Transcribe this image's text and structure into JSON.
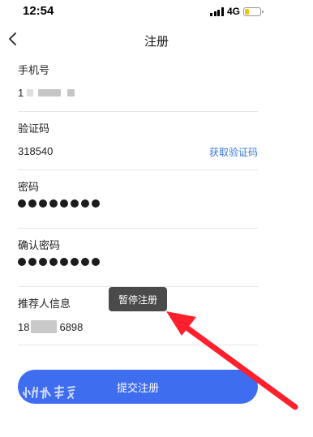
{
  "status_bar": {
    "time": "12:54",
    "network": "4G",
    "battery_level": 0.25,
    "battery_color": "#f5c400"
  },
  "nav": {
    "title": "注册",
    "back_icon": "chevron-left-icon"
  },
  "form": {
    "phone": {
      "label": "手机号",
      "value_prefix": "1",
      "value_suffix": ""
    },
    "code": {
      "label": "验证码",
      "value": "318540",
      "action_label": "获取验证码"
    },
    "password": {
      "label": "密码",
      "dot_count": 8
    },
    "confirm_password": {
      "label": "确认密码",
      "dot_count": 8
    },
    "referrer": {
      "label": "推荐人信息",
      "value_prefix": "18",
      "value_suffix": "6898"
    }
  },
  "tooltip": {
    "text": "暂停注册"
  },
  "submit": {
    "label": "提交注册"
  },
  "colors": {
    "accent": "#3f6df0",
    "link": "#3a78d8",
    "annotation_arrow": "#ff1f2d"
  }
}
